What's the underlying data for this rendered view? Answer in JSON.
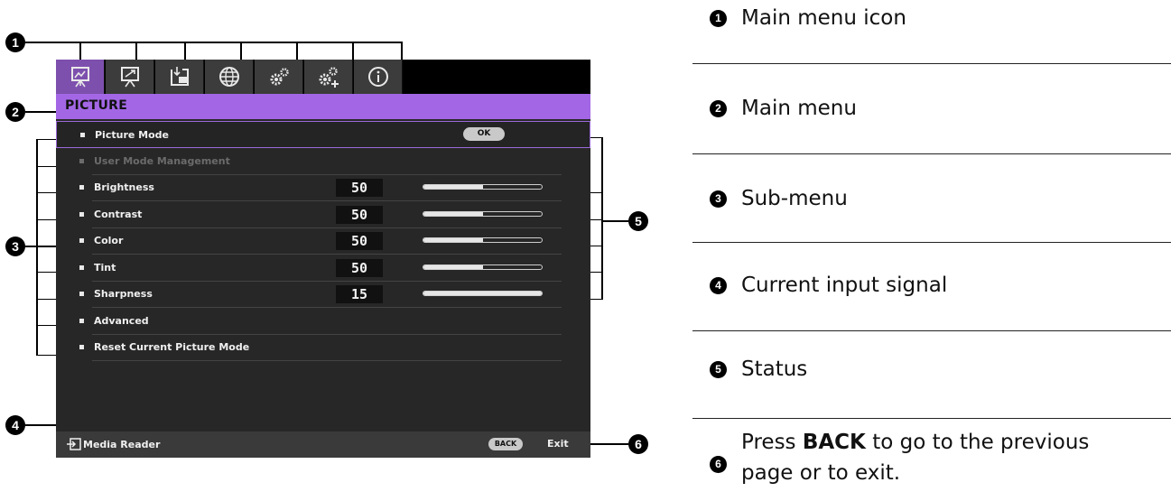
{
  "osd": {
    "tabs": [
      {
        "icon": "picture-presentation-icon",
        "active": true
      },
      {
        "icon": "display-adjust-icon",
        "active": false
      },
      {
        "icon": "input-source-icon",
        "active": false
      },
      {
        "icon": "globe-icon",
        "active": false
      },
      {
        "icon": "settings-gears-icon",
        "active": false
      },
      {
        "icon": "advanced-settings-icon",
        "active": false
      },
      {
        "icon": "info-icon",
        "active": false
      }
    ],
    "menu_title": "PICTURE",
    "items": [
      {
        "label": "Picture Mode",
        "selected": true,
        "control": "OK"
      },
      {
        "label": "User Mode Management",
        "disabled": true
      },
      {
        "label": "Brightness",
        "value": "50",
        "level": 0.5
      },
      {
        "label": "Contrast",
        "value": "50",
        "level": 0.5
      },
      {
        "label": "Color",
        "value": "50",
        "level": 0.5
      },
      {
        "label": "Tint",
        "value": "50",
        "level": 0.5
      },
      {
        "label": "Sharpness",
        "value": "15",
        "level": 1.0
      },
      {
        "label": "Advanced"
      },
      {
        "label": "Reset Current Picture Mode"
      }
    ],
    "input_source": "Media Reader",
    "back_button": "BACK",
    "exit_label": "Exit",
    "accent_color": "#a367e6"
  },
  "legend": [
    {
      "num": "1",
      "text": "Main menu icon"
    },
    {
      "num": "2",
      "text": "Main menu"
    },
    {
      "num": "3",
      "text": "Sub-menu"
    },
    {
      "num": "4",
      "text": "Current input signal"
    },
    {
      "num": "5",
      "text": "Status"
    },
    {
      "num": "6",
      "text_prefix": "Press ",
      "text_bold": "BACK",
      "text_suffix": " to go to the previous",
      "text_line2": "page or to exit."
    }
  ]
}
